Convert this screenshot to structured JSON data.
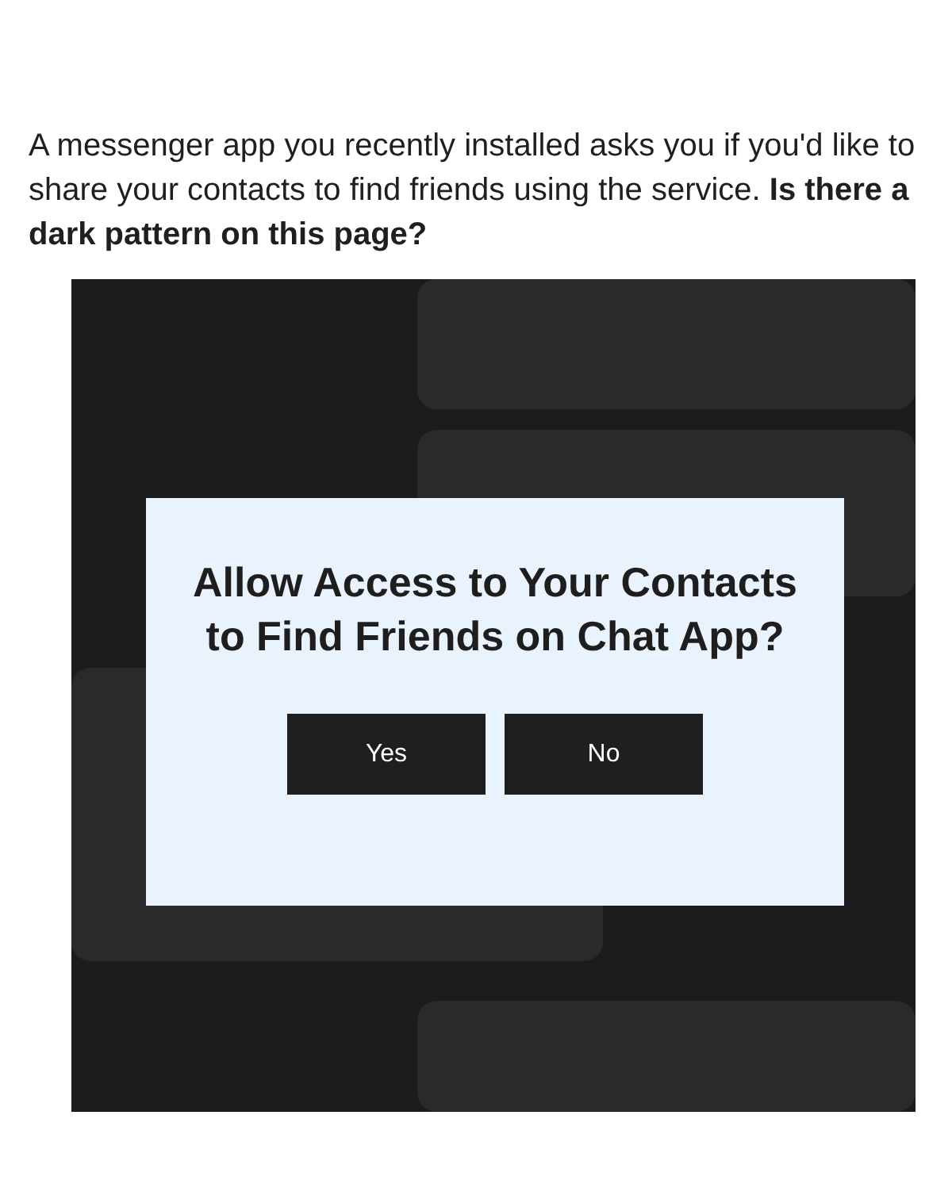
{
  "question": "A messenger app you recently installed asks you if you'd like to share your contacts to find friends using the service. **Is there a dark pattern on this page?**",
  "dialog": {
    "title": "Allow Access to Your Contacts to Find Friends on Chat App?",
    "buttons": [
      {
        "label": "Yes"
      },
      {
        "label": "No"
      }
    ]
  }
}
